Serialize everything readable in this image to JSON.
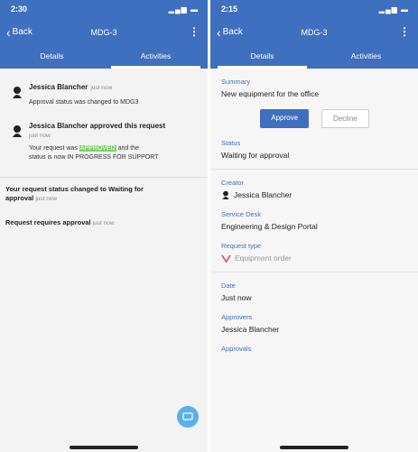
{
  "left": {
    "status_time": "2:30",
    "back": "Back",
    "title": "MDG-3",
    "more": "⋮",
    "tabs": [
      "Details",
      "Activities"
    ],
    "activities": [
      {
        "name": "Jessica Blancher",
        "when": "just now",
        "text": "Approval status was changed to MDG3"
      },
      {
        "name": "Jessica Blancher approved this request",
        "when": "just now",
        "text_before": "Your request was ",
        "highlight": "APPROVED",
        "text_after": " and the",
        "text2": "status is now IN PROGRESS FOR SUPPORT"
      }
    ],
    "status_change_1": "Your request status changed to Waiting for",
    "status_change_2": "approval",
    "status_change_when": "just now",
    "approval_text": "Request requires approval",
    "approval_when": "just now"
  },
  "right": {
    "status_time": "2:15",
    "back": "Back",
    "title": "MDG-3",
    "more": "⋮",
    "tabs": [
      "Details",
      "Activities"
    ],
    "summary_label": "Summary",
    "summary_value": "New equipment for the office",
    "approve_label": "Approve",
    "decline_label": "Decline",
    "status_label": "Status",
    "status_value": "Waiting for approval",
    "creator_label": "Creator",
    "creator_value": "Jessica Blancher",
    "service_desk_label": "Service Desk",
    "service_desk_value": "Engineering & Design Portal",
    "request_type_label": "Request type",
    "request_type_value": "Equipment order",
    "date_label": "Date",
    "date_value": "Just now",
    "approvers_label": "Approvers",
    "approvers_value": "Jessica Blancher",
    "approvals_label": "Approvals"
  },
  "colors": {
    "primary": "#3f6fbf",
    "fab": "#5ab0ec",
    "approved": "#7bd36b"
  }
}
